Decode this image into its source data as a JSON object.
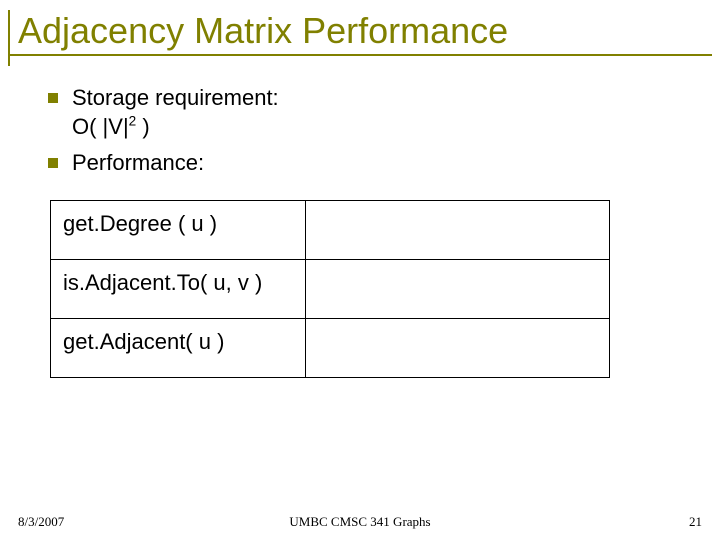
{
  "title": "Adjacency Matrix Performance",
  "bullets": {
    "storage_line1": "Storage requirement:",
    "storage_line2_prefix": "O( |V|",
    "storage_line2_exp": "2",
    "storage_line2_suffix": " )",
    "performance_label": "Performance:"
  },
  "table": {
    "rows": [
      {
        "op": "get.Degree ( u )",
        "val": ""
      },
      {
        "op": "is.Adjacent.To( u, v )",
        "val": ""
      },
      {
        "op": "get.Adjacent( u )",
        "val": ""
      }
    ]
  },
  "footer": {
    "date": "8/3/2007",
    "course": "UMBC CMSC 341 Graphs",
    "page": "21"
  }
}
